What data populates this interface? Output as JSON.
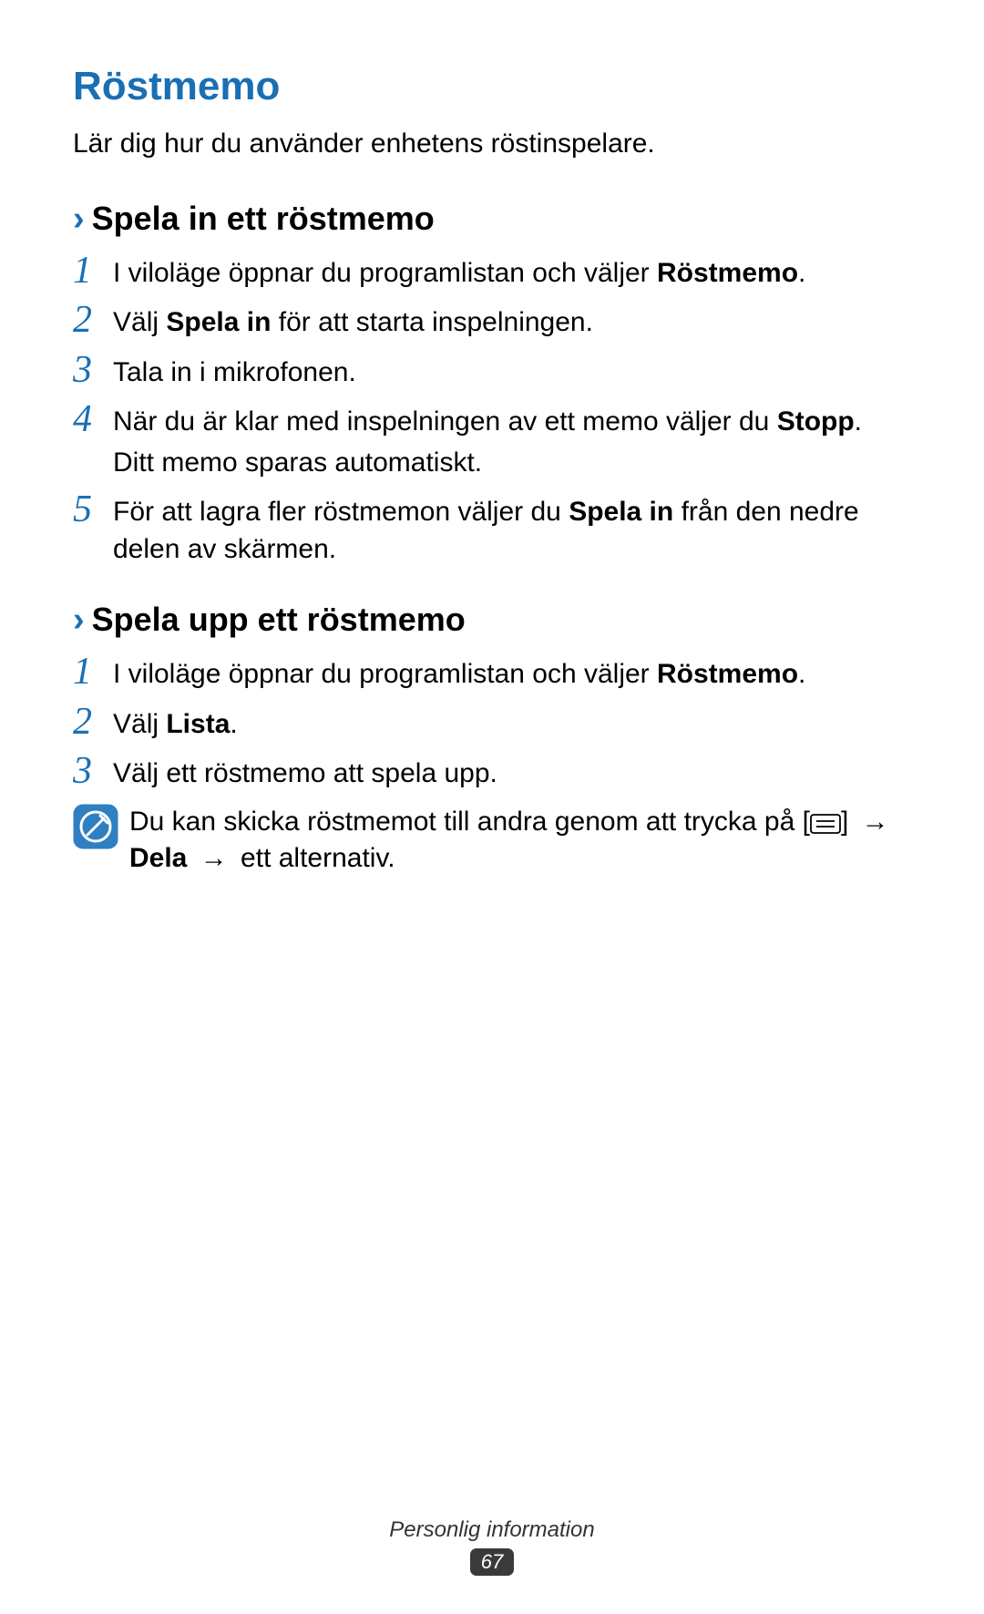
{
  "title": "Röstmemo",
  "intro": "Lär dig hur du använder enhetens röstinspelare.",
  "section1": {
    "heading": "Spela in ett röstmemo",
    "step1_a": "I viloläge öppnar du programlistan och väljer ",
    "step1_b": "Röstmemo",
    "step1_c": ".",
    "step2_a": "Välj ",
    "step2_b": "Spela in",
    "step2_c": " för att starta inspelningen.",
    "step3": "Tala in i mikrofonen.",
    "step4_a": "När du är klar med inspelningen av ett memo väljer du ",
    "step4_b": "Stopp",
    "step4_c": ".",
    "step4_sub": "Ditt memo sparas automatiskt.",
    "step5_a": "För att lagra fler röstmemon väljer du ",
    "step5_b": "Spela in",
    "step5_c": " från den nedre delen av skärmen."
  },
  "section2": {
    "heading": "Spela upp ett röstmemo",
    "step1_a": "I viloläge öppnar du programlistan och väljer ",
    "step1_b": "Röstmemo",
    "step1_c": ".",
    "step2_a": "Välj ",
    "step2_b": "Lista",
    "step2_c": ".",
    "step3": "Välj ett röstmemo att spela upp.",
    "note_a": "Du kan skicka röstmemot till andra genom att trycka på [",
    "note_b": "] ",
    "note_arrow1": "→",
    "note_c": "Dela",
    "note_arrow2": "→",
    "note_d": " ett alternativ."
  },
  "numbers": {
    "n1": "1",
    "n2": "2",
    "n3": "3",
    "n4": "4",
    "n5": "5"
  },
  "footer": {
    "text": "Personlig information",
    "page": "67"
  }
}
